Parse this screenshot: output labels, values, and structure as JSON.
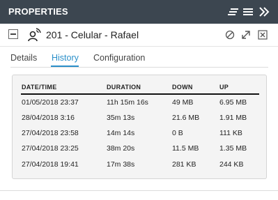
{
  "panel": {
    "title": "PROPERTIES"
  },
  "titlebar_icons": [
    "sort-lines-icon",
    "hamburger-menu-icon",
    "double-chevron-right-icon"
  ],
  "entity": {
    "name": "201 - Celular - Rafael",
    "icon": "user-wireless-icon",
    "actions": [
      "disable-icon",
      "expand-arrow-icon",
      "close-box-icon"
    ]
  },
  "tabs": [
    {
      "label": "Details",
      "active": false
    },
    {
      "label": "History",
      "active": true
    },
    {
      "label": "Configuration",
      "active": false
    }
  ],
  "colors": {
    "titlebar": "#3c4650",
    "accent": "#2a8fc9",
    "panel_bg": "#f4f4f4"
  },
  "history": {
    "columns": [
      "DATE/TIME",
      "DURATION",
      "DOWN",
      "UP"
    ],
    "rows": [
      [
        "01/05/2018 23:37",
        "11h 15m 16s",
        "49 MB",
        "6.95 MB"
      ],
      [
        "28/04/2018 3:16",
        "35m 13s",
        "21.6 MB",
        "1.91 MB"
      ],
      [
        "27/04/2018 23:58",
        "14m 14s",
        "0 B",
        "111 KB"
      ],
      [
        "27/04/2018 23:25",
        "38m 20s",
        "11.5 MB",
        "1.35 MB"
      ],
      [
        "27/04/2018 19:41",
        "17m 38s",
        "281 KB",
        "244 KB"
      ]
    ]
  }
}
